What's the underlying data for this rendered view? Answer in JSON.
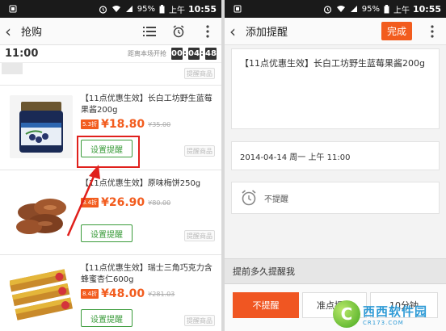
{
  "status": {
    "battery": "95%",
    "period": "上午",
    "time": "10:55"
  },
  "left": {
    "title": "抢购",
    "countdown": {
      "hour": "11:00",
      "label": "距离本场开抢",
      "h": "00",
      "m": "04",
      "s": "48"
    },
    "partial_btn": "提醒商品",
    "items": [
      {
        "name": "【11点优惠生效】长白工坊野生蓝莓果酱200g",
        "discount": "5.3折",
        "price": "¥18.80",
        "old_price": "¥35.00",
        "set_btn": "设置提醒",
        "gray_btn": "提醒商品"
      },
      {
        "name": "【11点优惠生效】原味梅饼250g",
        "discount": "3.4折",
        "price": "¥26.90",
        "old_price": "¥80.00",
        "set_btn": "设置提醒",
        "gray_btn": "提醒商品"
      },
      {
        "name": "【11点优惠生效】瑞士三角巧克力含蜂蜜杏仁600g",
        "discount": "8.4折",
        "price": "¥48.00",
        "old_price": "¥281.03",
        "set_btn": "设置提醒",
        "gray_btn": "提醒商品"
      }
    ]
  },
  "right": {
    "title": "添加提醒",
    "done": "完成",
    "reminder_text": "【11点优惠生效】长白工坊野生蓝莓果酱200g",
    "datetime": "2014-04-14 周一 上午 11:00",
    "alarm_label": "不提醒",
    "advance_label": "提前多久提醒我",
    "options": [
      "不提醒",
      "准点提醒",
      "10分钟"
    ]
  },
  "watermark": {
    "logo_letter": "C",
    "main_a": "西西",
    "main_b": "软件园",
    "sub": "CR173.COM"
  },
  "colors": {
    "accent": "#f25c1e",
    "green": "#3a9b3a",
    "highlight": "#e0201c"
  }
}
